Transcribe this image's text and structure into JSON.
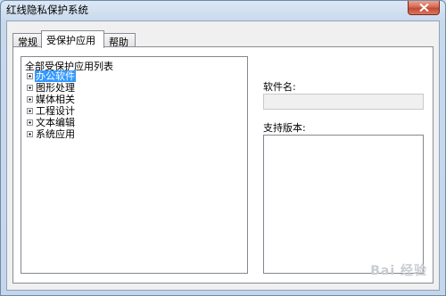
{
  "window": {
    "title": "红线隐私保护系统"
  },
  "tabs": [
    {
      "label": "常规",
      "active": false
    },
    {
      "label": "受保护应用",
      "active": true
    },
    {
      "label": "帮助",
      "active": false
    }
  ],
  "tree": {
    "root_label": "全部受保护应用列表",
    "items": [
      {
        "label": "办公软件",
        "selected": true
      },
      {
        "label": "图形处理",
        "selected": false
      },
      {
        "label": "媒体相关",
        "selected": false
      },
      {
        "label": "工程设计",
        "selected": false
      },
      {
        "label": "文本编辑",
        "selected": false
      },
      {
        "label": "系统应用",
        "selected": false
      }
    ]
  },
  "details": {
    "software_name_label": "软件名:",
    "software_name_value": "",
    "supported_version_label": "支持版本:"
  },
  "watermark": {
    "text": "Bai 经验"
  },
  "colors": {
    "selection": "#3399ff",
    "close_button": "#c44a33"
  }
}
